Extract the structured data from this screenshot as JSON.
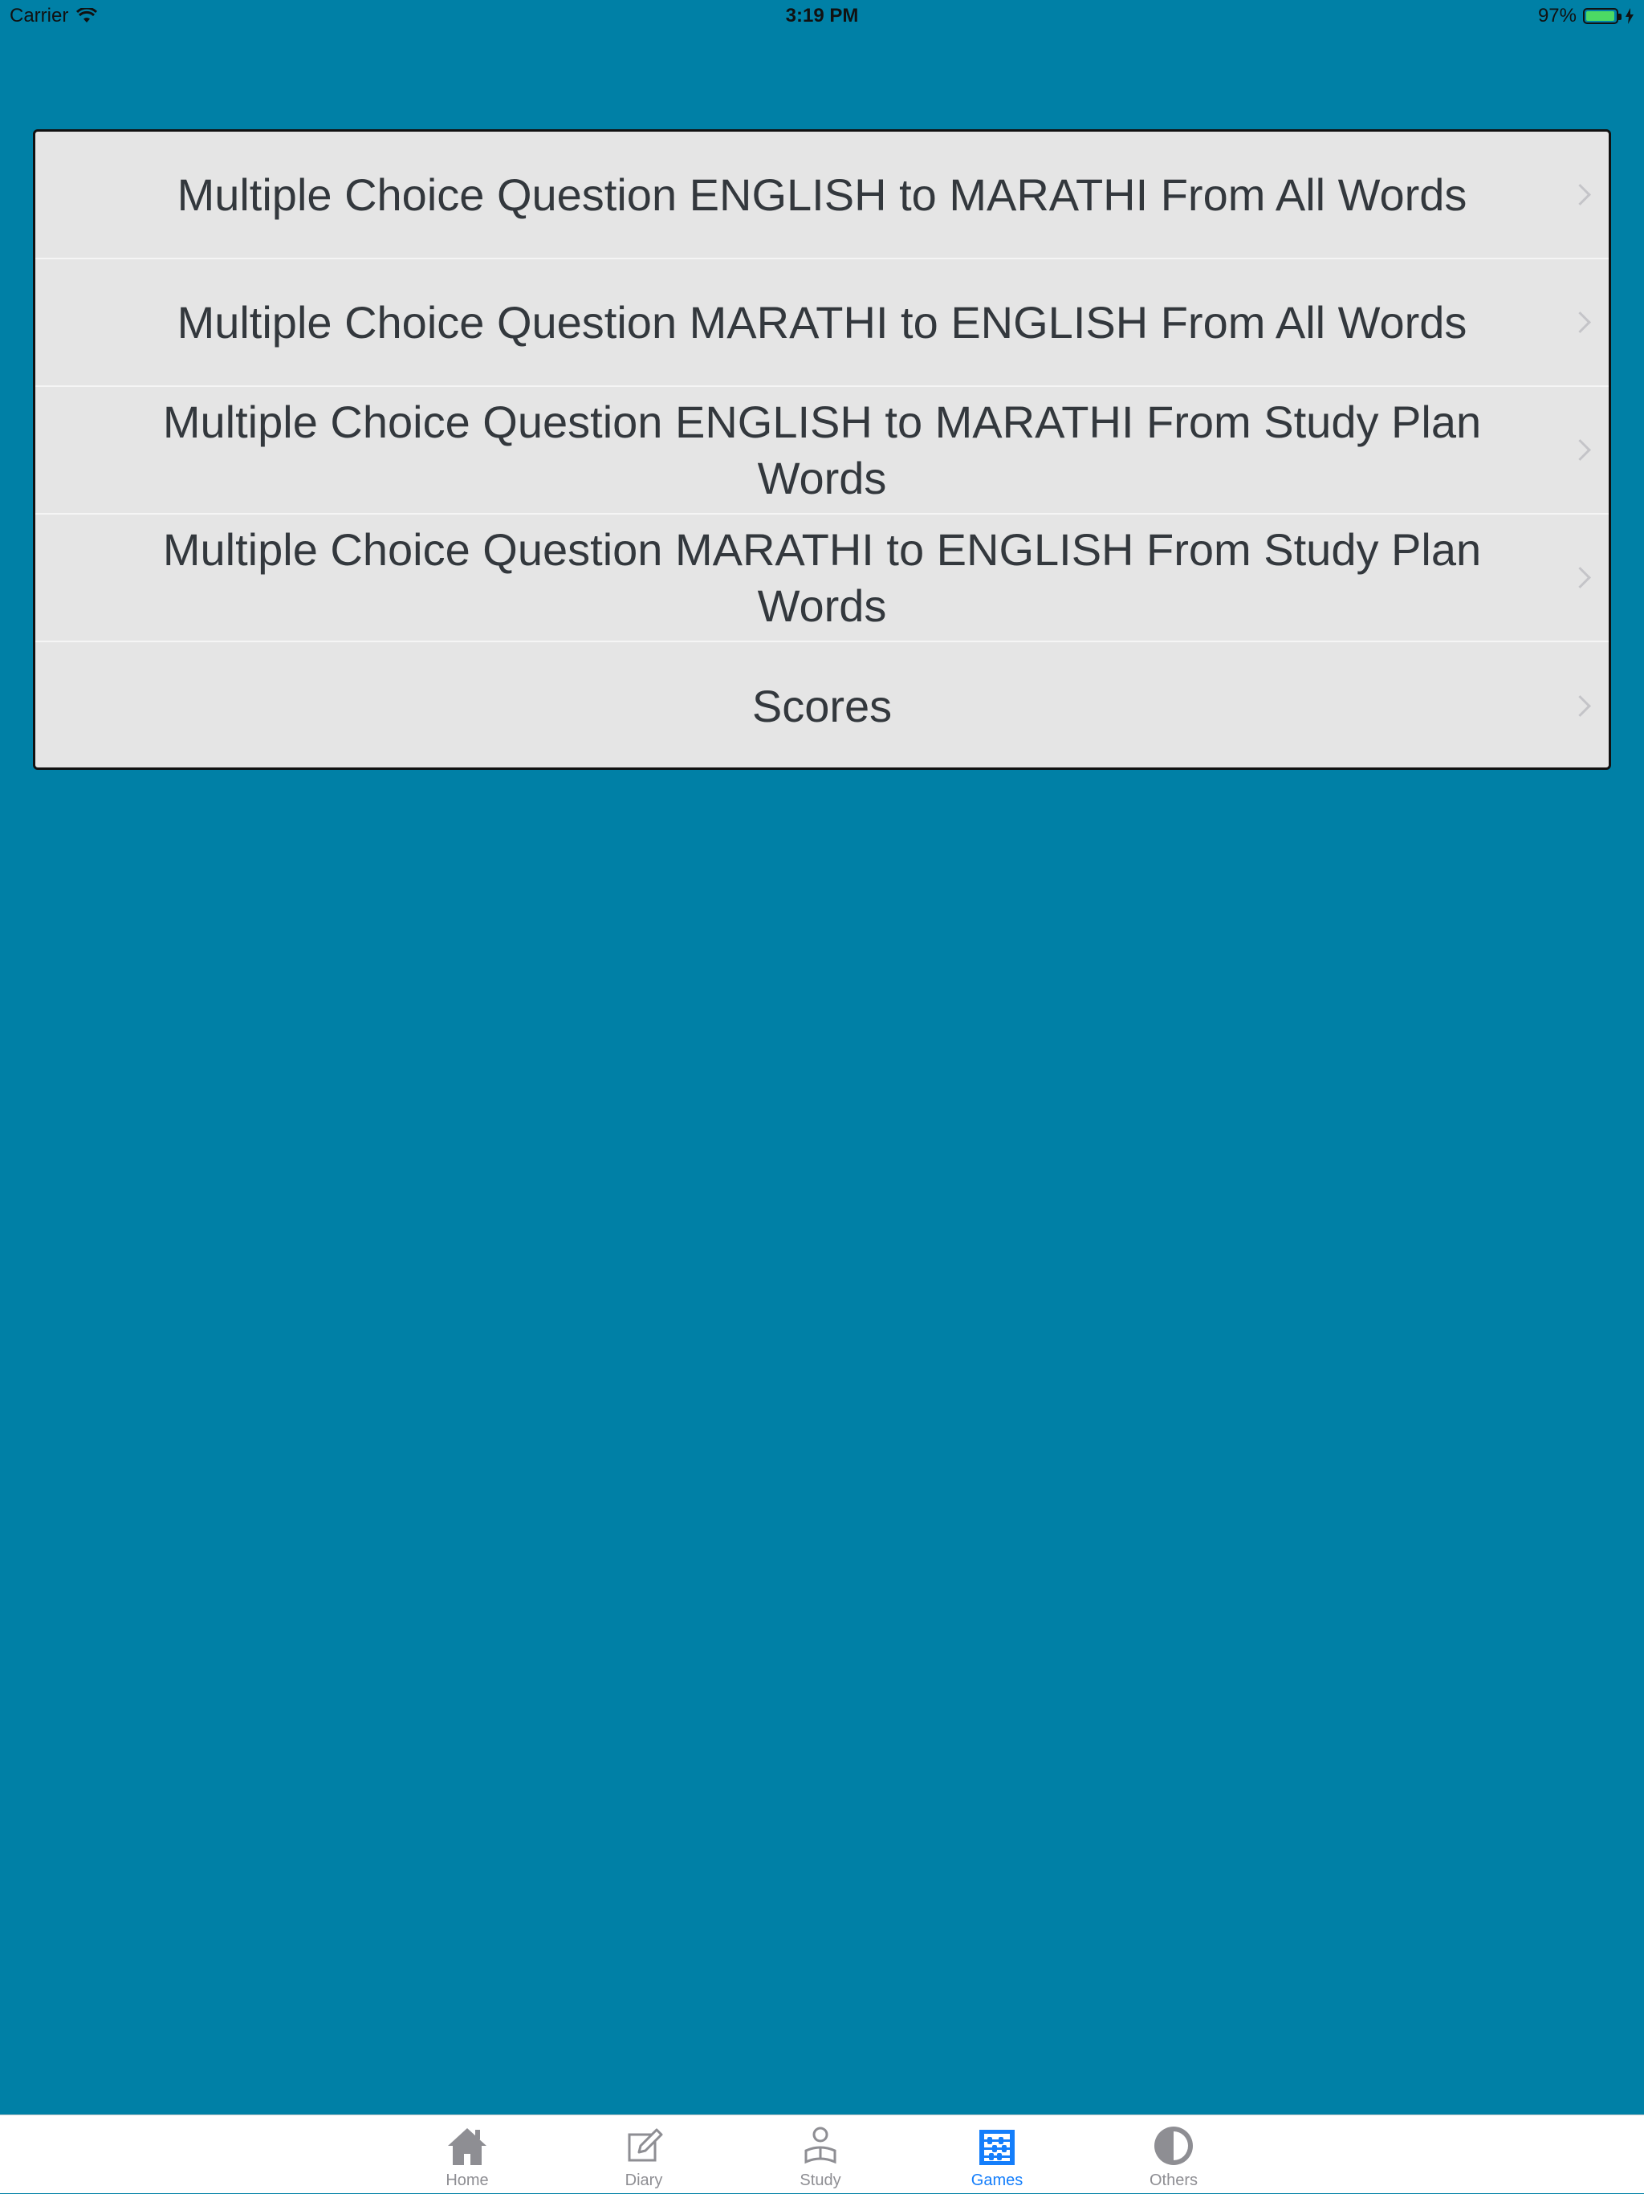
{
  "status_bar": {
    "carrier": "Carrier",
    "time": "3:19 PM",
    "battery_percent": "97%",
    "battery_level": 0.97
  },
  "menu": {
    "items": [
      {
        "label": "Multiple Choice Question ENGLISH to MARATHI From All Words"
      },
      {
        "label": "Multiple Choice Question MARATHI to ENGLISH From All Words"
      },
      {
        "label": "Multiple Choice Question ENGLISH to MARATHI From Study Plan Words"
      },
      {
        "label": "Multiple Choice Question MARATHI to ENGLISH From Study Plan Words"
      },
      {
        "label": "Scores"
      }
    ]
  },
  "tab_bar": {
    "active_color": "#147efb",
    "inactive_color": "#8e8e93",
    "tabs": [
      {
        "label": "Home",
        "icon": "home-icon"
      },
      {
        "label": "Diary",
        "icon": "diary-icon"
      },
      {
        "label": "Study",
        "icon": "study-icon"
      },
      {
        "label": "Games",
        "icon": "games-icon",
        "selected": true
      },
      {
        "label": "Others",
        "icon": "others-icon"
      }
    ]
  },
  "colors": {
    "background": "#0080a6",
    "card": "#e5e5e5",
    "text": "#33383d"
  }
}
